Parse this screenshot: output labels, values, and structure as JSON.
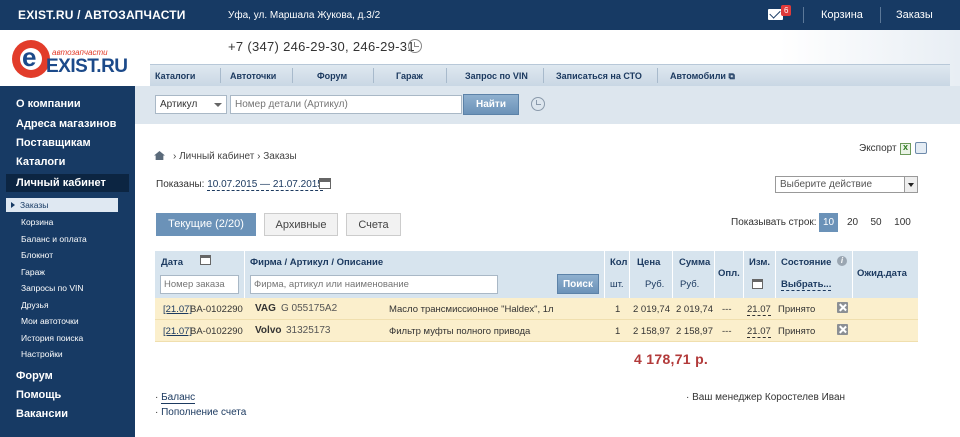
{
  "topbar": {
    "site_title": "EXIST.RU / АВТОЗАПЧАСТИ",
    "address": "Уфа, ул. Маршала Жукова, д.3/2",
    "mail_count": "6",
    "cart_label": "Корзина",
    "orders_label": "Заказы"
  },
  "header": {
    "logo_small": "автозапчасти",
    "logo_big": "EXIST.RU",
    "phone": "+7 (347) 246-29-30, 246-29-31"
  },
  "nav": {
    "items": [
      "Каталоги",
      "Автоточки",
      "Форум",
      "Гараж",
      "Запрос по VIN",
      "Записаться на СТО",
      "Автомобили ⧉"
    ]
  },
  "search": {
    "mode": "Артикул",
    "placeholder": "Номер детали (Артикул)",
    "button": "Найти"
  },
  "sidebar": {
    "top_items": [
      "О компании",
      "Адреса магазинов",
      "Поставщикам",
      "Каталоги"
    ],
    "active_item": "Личный кабинет",
    "sub_active": "Заказы",
    "sub_items": [
      "Корзина",
      "Баланс и оплата",
      "Блокнот",
      "Гараж",
      "Запросы по VIN",
      "Друзья",
      "Мои автоточки",
      "История поиска",
      "Настройки"
    ],
    "bottom_items": [
      "Форум",
      "Помощь",
      "Вакансии"
    ]
  },
  "breadcrumb": {
    "level1": "Личный кабинет",
    "level2": "Заказы"
  },
  "export_label": "Экспорт",
  "shown": {
    "label": "Показаны:",
    "range": "10.07.2015 — 21.07.2015"
  },
  "action_select": "Выберите действие",
  "tabs": {
    "current": "Текущие (2/20)",
    "archive": "Архивные",
    "bills": "Счета"
  },
  "rows_per_page": {
    "label": "Показывать строк:",
    "options": [
      "10",
      "20",
      "50",
      "100"
    ],
    "selected": "10"
  },
  "table": {
    "headers": {
      "date": "Дата",
      "firm": "Фирма / Артикул / Описание",
      "qty_top": "Кол",
      "qty_bottom": "шт.",
      "price_top": "Цена",
      "price_bottom": "Руб.",
      "sum_top": "Сумма",
      "sum_bottom": "Руб.",
      "opl": "Опл.",
      "izm": "Изм.",
      "state": "Состояние",
      "state_choose": "Выбрать...",
      "expected": "Ожид.дата",
      "search_button": "Поиск"
    },
    "order_placeholder": "Номер заказа",
    "firm_placeholder": "Фирма, артикул или наименование",
    "rows": [
      {
        "date": "[21.07]",
        "order": "BA-0102290",
        "brand": "VAG",
        "article": "G 055175A2",
        "desc": "Масло трансмиссионное \"Haldex\", 1л",
        "qty": "1",
        "price": "2 019,74",
        "sum": "2 019,74",
        "opl": "---",
        "izm": "21.07",
        "state": "Принято"
      },
      {
        "date": "[21.07]",
        "order": "BA-0102290",
        "brand": "Volvo",
        "article": "31325173",
        "desc": "Фильтр муфты полного привода",
        "qty": "1",
        "price": "2 158,97",
        "sum": "2 158,97",
        "opl": "---",
        "izm": "21.07",
        "state": "Принято"
      }
    ]
  },
  "total": "4 178,71 р.",
  "footer": {
    "balance": "Баланс",
    "topup": "Пополнение счета",
    "manager": "Ваш менеджер Коростелев Иван"
  }
}
